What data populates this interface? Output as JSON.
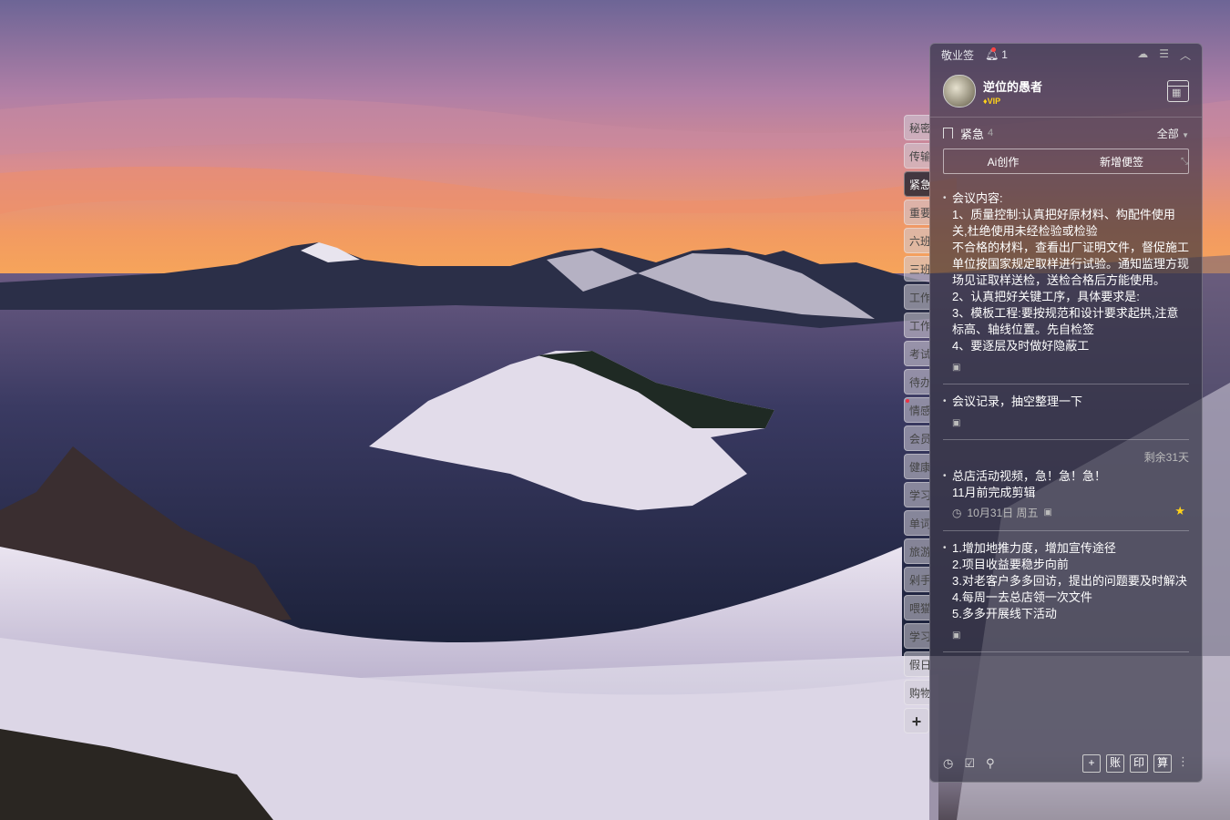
{
  "desktop": {
    "wallpaper": "crater-lake-sunset"
  },
  "side_tabs": [
    {
      "label": "秘密",
      "active": false,
      "dot": false
    },
    {
      "label": "传输",
      "active": false,
      "dot": false
    },
    {
      "label": "紧急",
      "active": true,
      "dot": false
    },
    {
      "label": "重要",
      "active": false,
      "dot": false
    },
    {
      "label": "六班",
      "active": false,
      "dot": false
    },
    {
      "label": "三班",
      "active": false,
      "dot": false
    },
    {
      "label": "工作",
      "active": false,
      "dot": false
    },
    {
      "label": "工作",
      "active": false,
      "dot": false
    },
    {
      "label": "考试",
      "active": false,
      "dot": false
    },
    {
      "label": "待办",
      "active": false,
      "dot": false
    },
    {
      "label": "情感",
      "active": false,
      "dot": true
    },
    {
      "label": "会员",
      "active": false,
      "dot": false
    },
    {
      "label": "健康",
      "active": false,
      "dot": false
    },
    {
      "label": "学习",
      "active": false,
      "dot": false
    },
    {
      "label": "单词",
      "active": false,
      "dot": false
    },
    {
      "label": "旅游",
      "active": false,
      "dot": false
    },
    {
      "label": "剁手",
      "active": false,
      "dot": false
    },
    {
      "label": "喂猫",
      "active": false,
      "dot": false
    },
    {
      "label": "学习",
      "active": false,
      "dot": false
    },
    {
      "label": "假日",
      "active": false,
      "dot": false
    },
    {
      "label": "购物",
      "active": false,
      "dot": false
    }
  ],
  "add_tab": "+",
  "titlebar": {
    "app_name": "敬业签",
    "notification_count": "1"
  },
  "user": {
    "name": "逆位的愚者",
    "badge": "VIP"
  },
  "category": {
    "name": "紧急",
    "count": "4",
    "filter": "全部"
  },
  "actions": {
    "ai": "Ai创作",
    "new_note": "新增便签"
  },
  "notes": [
    {
      "text": "会议内容:\n1、质量控制:认真把好原材料、构配件使用关,杜绝使用未经检验或检验\n不合格的材料，查看出厂证明文件，督促施工单位按国家规定取样进行试验。通知监理方现场见证取样送检，送检合格后方能使用。\n2、认真把好关键工序，具体要求是:\n3、模板工程:要按规范和设计要求起拱,注意标高、轴线位置。先自检签\n4、要逐层及时做好隐蔽工"
    },
    {
      "text": "会议记录，抽空整理一下"
    },
    {
      "remaining": "剩余31天",
      "text": "总店活动视频，急！急！急！\n11月前完成剪辑",
      "date": "10月31日 周五"
    },
    {
      "text": "1.增加地推力度，增加宣传途径\n2.项目收益要稳步向前\n3.对老客户多多回访，提出的问题要及时解决\n4.每周一去总店领一次文件\n5.多多开展线下活动"
    }
  ],
  "footer": {
    "buttons": [
      "账",
      "印",
      "算"
    ]
  }
}
